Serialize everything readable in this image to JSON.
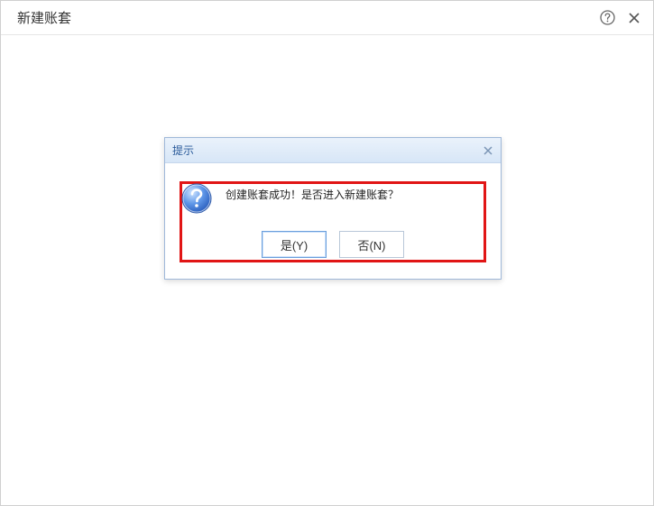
{
  "window": {
    "title": "新建账套"
  },
  "dialog": {
    "title": "提示",
    "message": "创建账套成功！是否进入新建账套？",
    "buttons": {
      "yes": "是(Y)",
      "no": "否(N)"
    }
  }
}
